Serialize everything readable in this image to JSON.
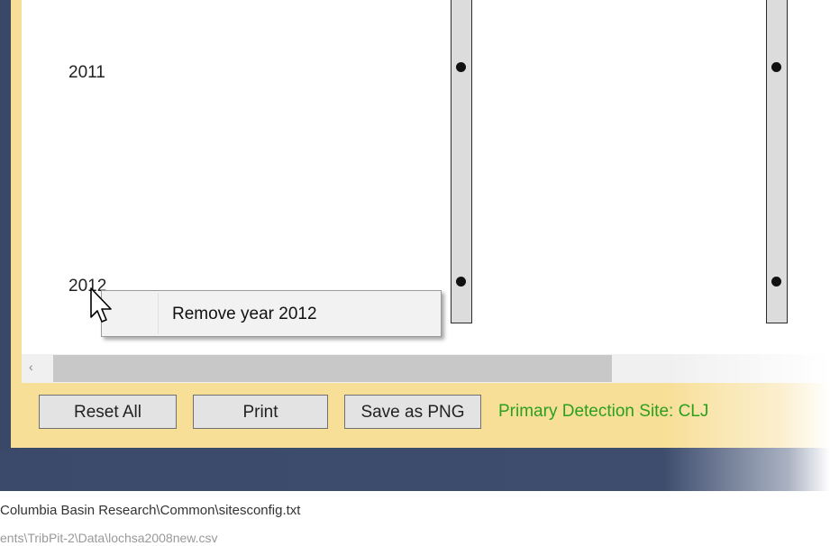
{
  "chart_area": {
    "years": [
      "2011",
      "2012"
    ]
  },
  "context_menu": {
    "items": [
      "Remove year 2012"
    ]
  },
  "toolbar": {
    "reset_label": "Reset All",
    "print_label": "Print",
    "save_label": "Save as PNG",
    "status": "Primary Detection Site: CLJ",
    "status_color": "#2aa01e"
  },
  "scrollbar": {
    "left_arrow": "‹"
  },
  "file_paths": [
    "Columbia Basin Research\\Common\\sitesconfig.txt",
    "ents\\TribPit-2\\Data\\lochsa2008new.csv"
  ],
  "icons": {
    "cursor": "arrow-cursor-icon"
  }
}
